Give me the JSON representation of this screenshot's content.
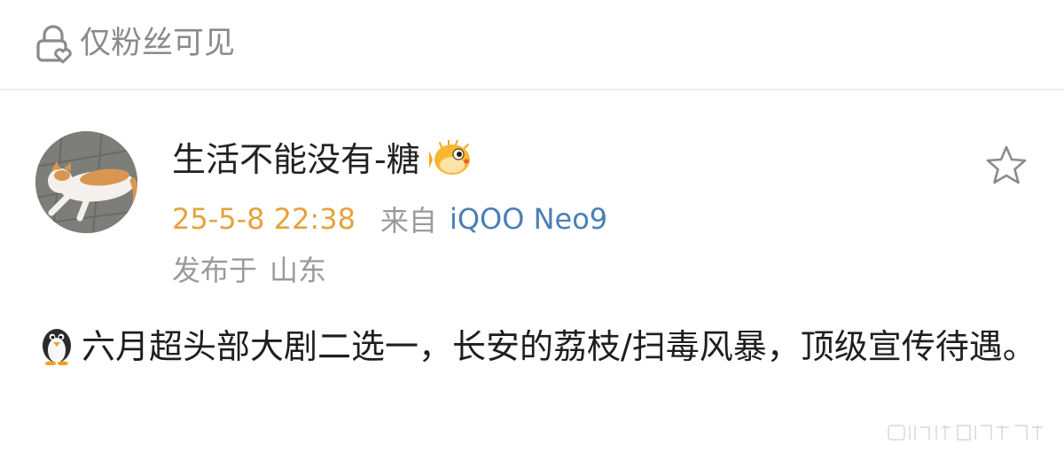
{
  "header": {
    "visibility_label": "仅粉丝可见",
    "visibility_icon": "lock-heart-icon"
  },
  "post": {
    "author_name": "生活不能没有-糖",
    "author_badge_icon": "pufferfish-emoji-icon",
    "time": "25-5-8 22:38",
    "from_label": "来自",
    "device": "iQOO Neo9",
    "location_prefix": "发布于",
    "location": "山东",
    "favorite_icon": "star-outline-icon",
    "content_emoji_icon": "penguin-emoji-icon",
    "content_text": "六月超头部大剧二选一，长安的荔枝/扫毒风暴，顶级宣传待遇。"
  },
  "colors": {
    "time": "#e6a23c",
    "device_link": "#4a7fb5",
    "muted": "#9a9a9a"
  }
}
